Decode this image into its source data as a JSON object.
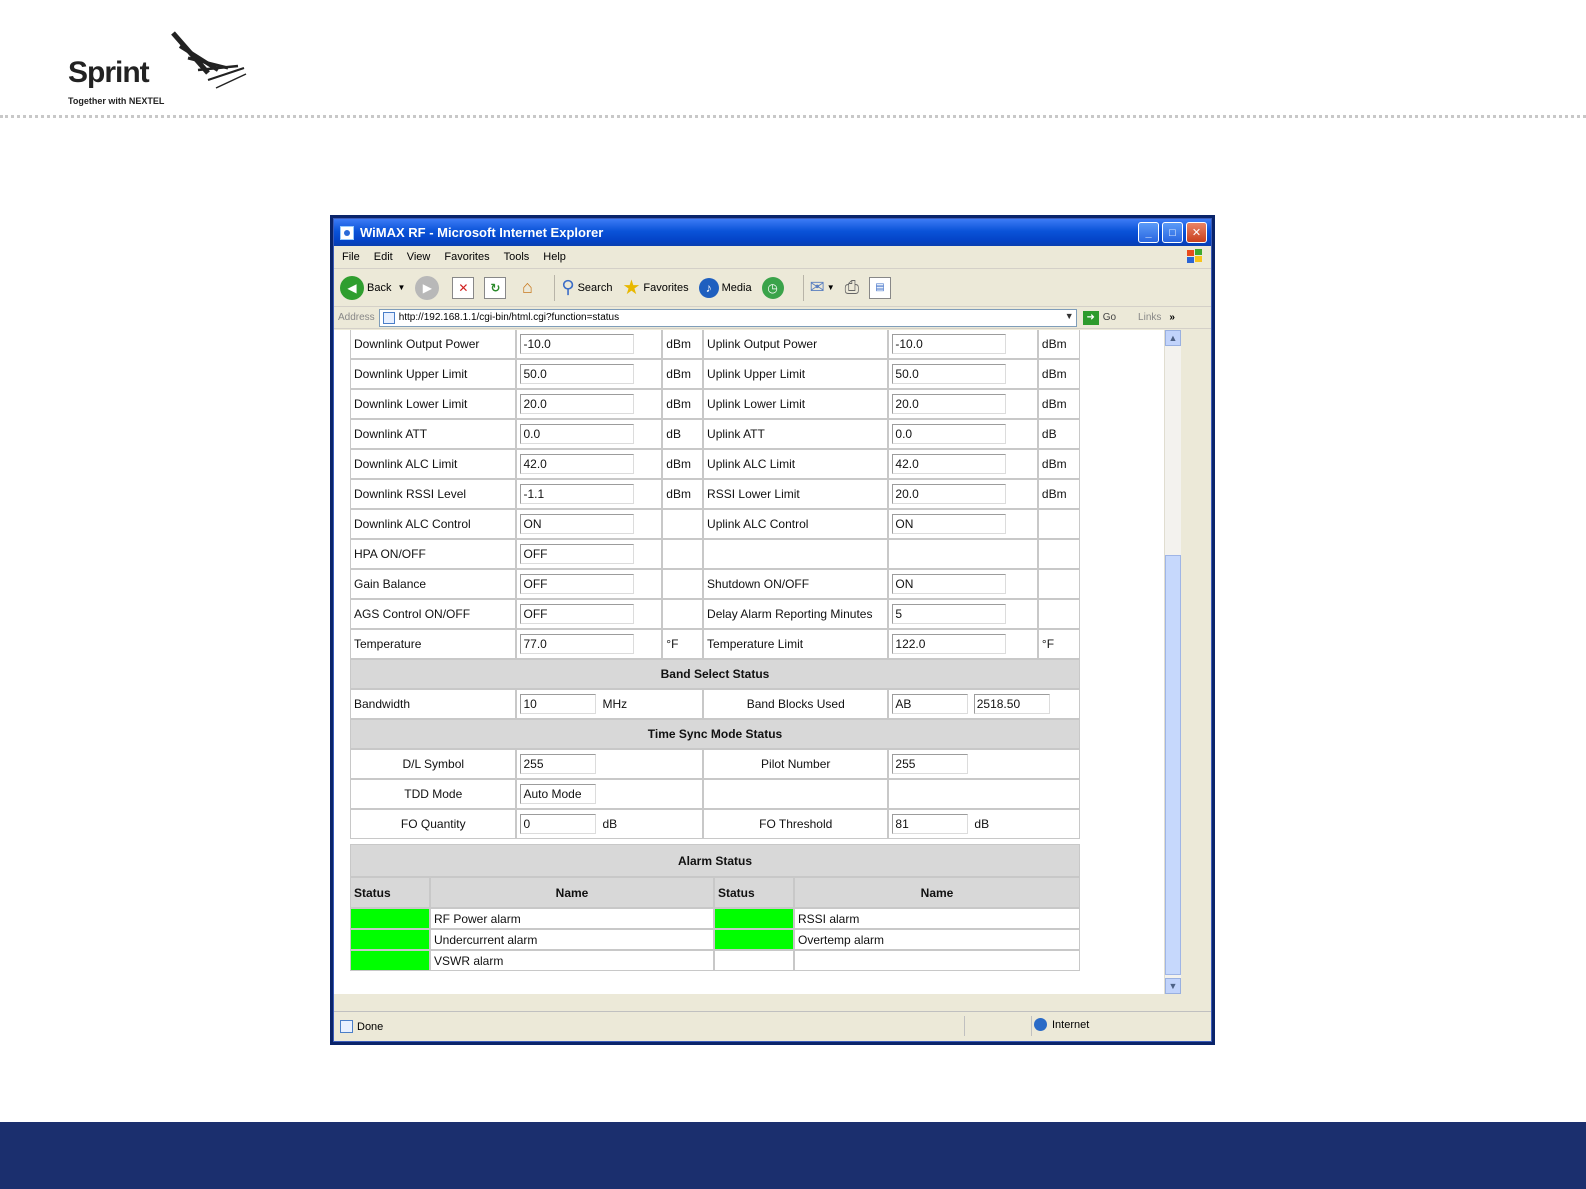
{
  "slide": {
    "logo_word": "Sprint",
    "logo_tagline": "Together with NEXTEL",
    "footer_color": "#1b2f6e"
  },
  "window": {
    "title": "WiMAX RF - Microsoft Internet Explorer",
    "menu": [
      "File",
      "Edit",
      "View",
      "Favorites",
      "Tools",
      "Help"
    ],
    "toolbar": {
      "back": "Back",
      "search": "Search",
      "favorites": "Favorites",
      "media": "Media"
    },
    "address_label": "Address",
    "url": "http://192.168.1.1/cgi-bin/html.cgi?function=status",
    "go": "Go",
    "links": "Links",
    "status_text": "Done",
    "zone": "Internet"
  },
  "rows": [
    {
      "l_label": "Downlink Output Power",
      "l_value": "-10.0",
      "l_unit": "dBm",
      "r_label": "Uplink Output Power",
      "r_value": "-10.0",
      "r_unit": "dBm"
    },
    {
      "l_label": "Downlink Upper Limit",
      "l_value": "50.0",
      "l_unit": "dBm",
      "r_label": "Uplink Upper Limit",
      "r_value": "50.0",
      "r_unit": "dBm"
    },
    {
      "l_label": "Downlink Lower Limit",
      "l_value": "20.0",
      "l_unit": "dBm",
      "r_label": "Uplink Lower Limit",
      "r_value": "20.0",
      "r_unit": "dBm"
    },
    {
      "l_label": "Downlink ATT",
      "l_value": "0.0",
      "l_unit": "dB",
      "r_label": "Uplink ATT",
      "r_value": "0.0",
      "r_unit": "dB"
    },
    {
      "l_label": "Downlink ALC Limit",
      "l_value": "42.0",
      "l_unit": "dBm",
      "r_label": "Uplink ALC Limit",
      "r_value": "42.0",
      "r_unit": "dBm"
    },
    {
      "l_label": "Downlink RSSI Level",
      "l_value": "-1.1",
      "l_unit": "dBm",
      "r_label": "RSSI Lower Limit",
      "r_value": "20.0",
      "r_unit": "dBm"
    },
    {
      "l_label": "Downlink ALC Control",
      "l_value": "ON",
      "l_unit": "",
      "r_label": "Uplink ALC Control",
      "r_value": "ON",
      "r_unit": ""
    },
    {
      "l_label": "HPA ON/OFF",
      "l_value": "OFF",
      "l_unit": "",
      "r_label": "",
      "r_value": null,
      "r_unit": ""
    },
    {
      "l_label": "Gain Balance",
      "l_value": "OFF",
      "l_unit": "",
      "r_label": "Shutdown ON/OFF",
      "r_value": "ON",
      "r_unit": ""
    },
    {
      "l_label": "AGS Control ON/OFF",
      "l_value": "OFF",
      "l_unit": "",
      "r_label": "Delay Alarm Reporting Minutes",
      "r_value": "5",
      "r_unit": ""
    },
    {
      "l_label": "Temperature",
      "l_value": "77.0",
      "l_unit": "°F",
      "r_label": "Temperature Limit",
      "r_value": "122.0",
      "r_unit": "°F"
    }
  ],
  "band": {
    "title": "Band Select Status",
    "bandwidth_label": "Bandwidth",
    "bandwidth_value": "10",
    "bandwidth_unit": "MHz",
    "blocks_label": "Band Blocks Used",
    "blocks_value": "AB",
    "freq_value": "2518.50"
  },
  "timesync": {
    "title": "Time Sync Mode Status",
    "dl_symbol_label": "D/L Symbol",
    "dl_symbol_value": "255",
    "pilot_label": "Pilot Number",
    "pilot_value": "255",
    "tdd_label": "TDD Mode",
    "tdd_value": "Auto Mode",
    "fo_qty_label": "FO Quantity",
    "fo_qty_value": "0",
    "fo_qty_unit": "dB",
    "fo_thr_label": "FO Threshold",
    "fo_thr_value": "81",
    "fo_thr_unit": "dB"
  },
  "alarm": {
    "title": "Alarm Status",
    "status_header": "Status",
    "name_header": "Name",
    "status_color": "#00ff00",
    "left": [
      "RF Power alarm",
      "Undercurrent alarm",
      "VSWR alarm"
    ],
    "right": [
      "RSSI alarm",
      "Overtemp alarm"
    ]
  }
}
